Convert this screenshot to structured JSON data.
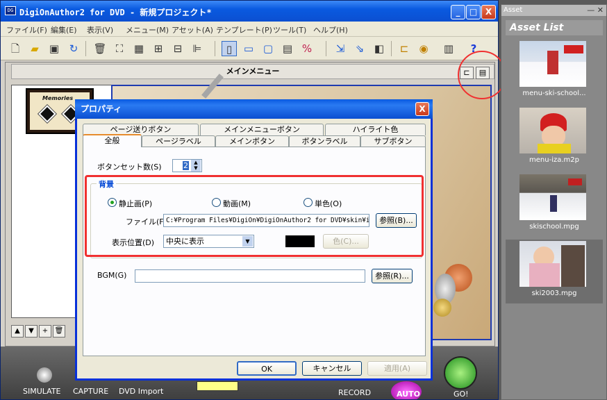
{
  "window": {
    "title": "DigiOnAuthor2 for DVD - 新規プロジェクト*",
    "min": "_",
    "max": "□",
    "close": "X"
  },
  "menu": [
    "ファイル(F)",
    "編集(E)",
    "表示(V)",
    "メニュー(M)",
    "アセット(A)",
    "テンプレート(P)",
    "ツール(T)",
    "ヘルプ(H)"
  ],
  "toolbar_icons": [
    "new-icon",
    "open-icon",
    "save-icon",
    "export-icon",
    "delete-icon",
    "fit-icon",
    "grid-icon",
    "group-icon",
    "ungroup-icon",
    "align-icon",
    "view-single-icon",
    "view-menu-icon",
    "view-preview-icon",
    "view-grid-icon",
    "zoom-icon",
    "link-icon",
    "navigate-icon",
    "layer-icon",
    "render-icon",
    "disc-icon",
    "settings-icon",
    "help-icon"
  ],
  "toolbar_help": "?",
  "menu_header": {
    "title": "メインメニュー"
  },
  "thumb": {
    "title": "Memories"
  },
  "bottom_bar": {
    "simulate": "SIMULATE",
    "capture": "CAPTURE",
    "dvd_import": "DVD Import",
    "record": "RECORD",
    "auto": "AUTO",
    "go": "GO!"
  },
  "asset_panel": {
    "caption": "Asset",
    "header": "Asset List",
    "items": [
      {
        "name": "menu-ski-school..."
      },
      {
        "name": "menu-iza.m2p"
      },
      {
        "name": "skischool.mpg"
      },
      {
        "name": "ski2003.mpg"
      }
    ]
  },
  "dialog": {
    "title": "プロパティ",
    "close": "X",
    "tabs_row1": [
      "ページ送りボタン",
      "メインメニューボタン",
      "ハイライト色"
    ],
    "tabs_row2": [
      "全般",
      "ページラベル",
      "メインボタン",
      "ボタンラベル",
      "サブボタン"
    ],
    "button_set_label": "ボタンセット数(S)",
    "button_set_value": "2",
    "background": {
      "legend": "背景",
      "radio_still": "静止画(P)",
      "radio_video": "動画(M)",
      "radio_solid": "単色(O)",
      "file_label": "ファイル(F)",
      "file_value": "C:¥Program Files¥DigiOn¥DigiOnAuthor2 for DVD¥skin¥im",
      "browse": "参照(B)...",
      "position_label": "表示位置(D)",
      "position_value": "中央に表示",
      "color_swatch": "#000000",
      "color_button": "色(C)..."
    },
    "bgm_label": "BGM(G)",
    "bgm_value": "",
    "bgm_browse": "参照(R)...",
    "ok": "OK",
    "cancel": "キャンセル",
    "apply": "適用(A)"
  }
}
